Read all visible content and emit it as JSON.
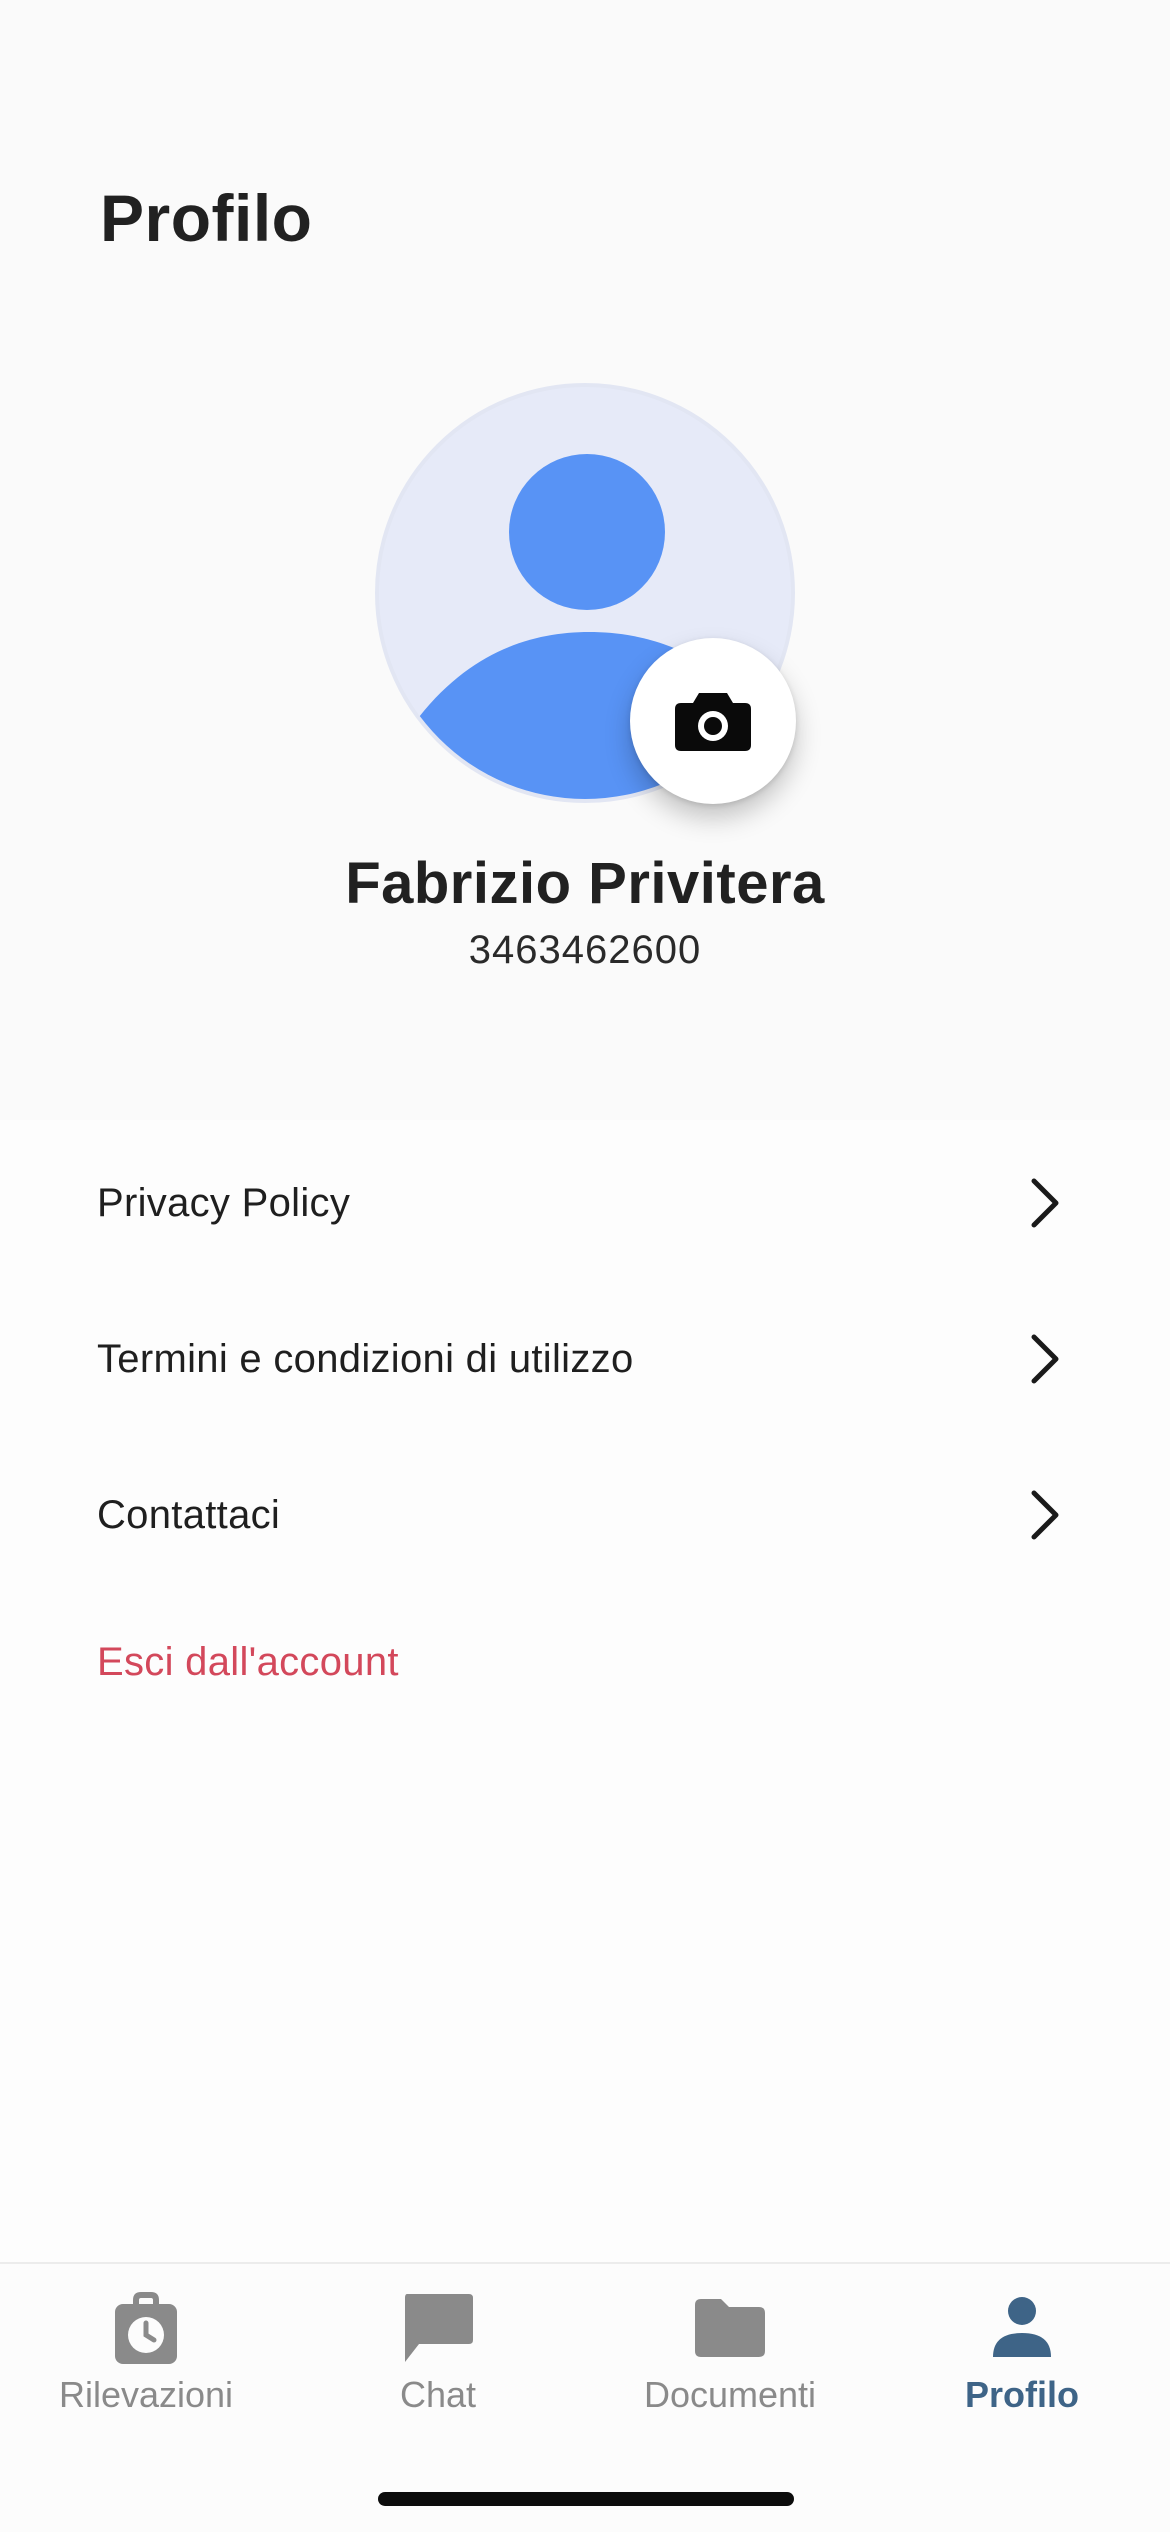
{
  "header": {
    "title": "Profilo"
  },
  "profile": {
    "name": "Fabrizio Privitera",
    "phone": "3463462600",
    "avatar_icon": "person-placeholder-icon",
    "camera_icon": "camera-icon"
  },
  "menu": {
    "items": [
      {
        "label": "Privacy Policy",
        "icon": "chevron-right-icon"
      },
      {
        "label": "Termini e condizioni di utilizzo",
        "icon": "chevron-right-icon"
      },
      {
        "label": "Contattaci",
        "icon": "chevron-right-icon"
      }
    ],
    "logout_label": "Esci dall'account"
  },
  "tabs": [
    {
      "label": "Rilevazioni",
      "icon": "stopwatch-bag-icon",
      "active": false
    },
    {
      "label": "Chat",
      "icon": "chat-bubble-icon",
      "active": false
    },
    {
      "label": "Documenti",
      "icon": "folder-icon",
      "active": false
    },
    {
      "label": "Profilo",
      "icon": "person-icon",
      "active": true
    }
  ],
  "colors": {
    "accent_tab": "#3e6487",
    "inactive_tab": "#8a8a8a",
    "logout": "#d3485b",
    "avatar_bg": "#e6eaf8",
    "avatar_fg": "#5893f5"
  }
}
